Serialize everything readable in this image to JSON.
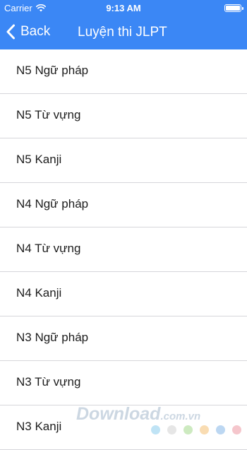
{
  "status_bar": {
    "carrier": "Carrier",
    "time": "9:13 AM"
  },
  "nav": {
    "back_label": "Back",
    "title": "Luyện thi JLPT"
  },
  "items": [
    {
      "label": "N5 Ngữ pháp"
    },
    {
      "label": "N5 Từ vựng"
    },
    {
      "label": "N5 Kanji"
    },
    {
      "label": "N4 Ngữ pháp"
    },
    {
      "label": "N4 Từ vựng"
    },
    {
      "label": "N4 Kanji"
    },
    {
      "label": "N3 Ngữ pháp"
    },
    {
      "label": "N3 Từ vựng"
    },
    {
      "label": "N3 Kanji"
    }
  ],
  "watermark": {
    "brand": "Download",
    "domain": ".com.vn",
    "dot_colors": [
      "#bfe3f5",
      "#e6e6e6",
      "#cdeac0",
      "#f9dcb2",
      "#bcd7f2",
      "#f5c6cc"
    ]
  },
  "colors": {
    "accent": "#3b87f5",
    "separator": "#d6d6da",
    "text": "#1c1c1c"
  },
  "icons": {
    "back": "chevron-left-icon",
    "wifi": "wifi-icon",
    "battery": "battery-icon"
  }
}
